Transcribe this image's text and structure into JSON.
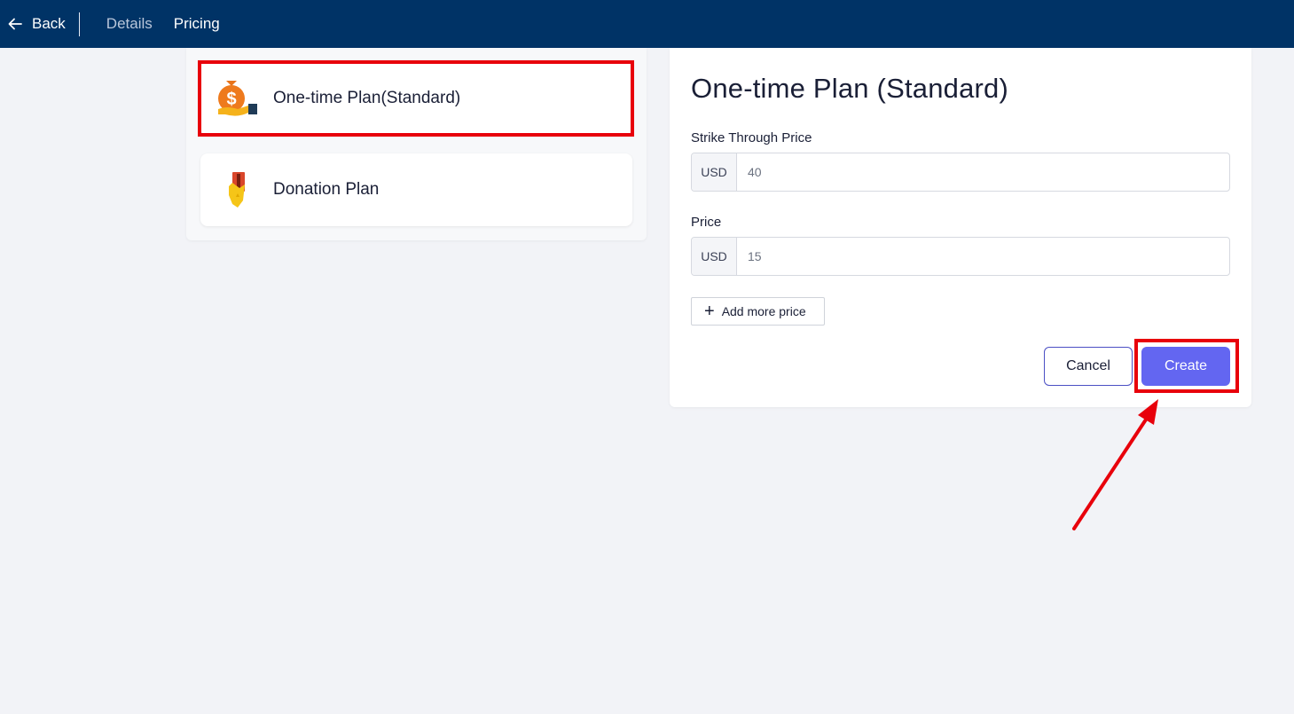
{
  "header": {
    "back_label": "Back",
    "tabs": [
      {
        "label": "Details",
        "active": false
      },
      {
        "label": "Pricing",
        "active": true
      }
    ]
  },
  "plans": [
    {
      "label": "One-time Plan(Standard)",
      "icon": "money-bag-hand-icon",
      "selected": true
    },
    {
      "label": "Donation Plan",
      "icon": "donation-hand-icon",
      "selected": false
    }
  ],
  "form": {
    "title": "One-time Plan (Standard)",
    "strike_price": {
      "label": "Strike Through Price",
      "currency": "USD",
      "value": "40"
    },
    "price": {
      "label": "Price",
      "currency": "USD",
      "value": "15"
    },
    "add_more_label": "Add more price",
    "cancel_label": "Cancel",
    "create_label": "Create"
  },
  "colors": {
    "topbar": "#003366",
    "primary": "#6366f1",
    "highlight": "#e8000b",
    "background": "#f2f3f7"
  }
}
